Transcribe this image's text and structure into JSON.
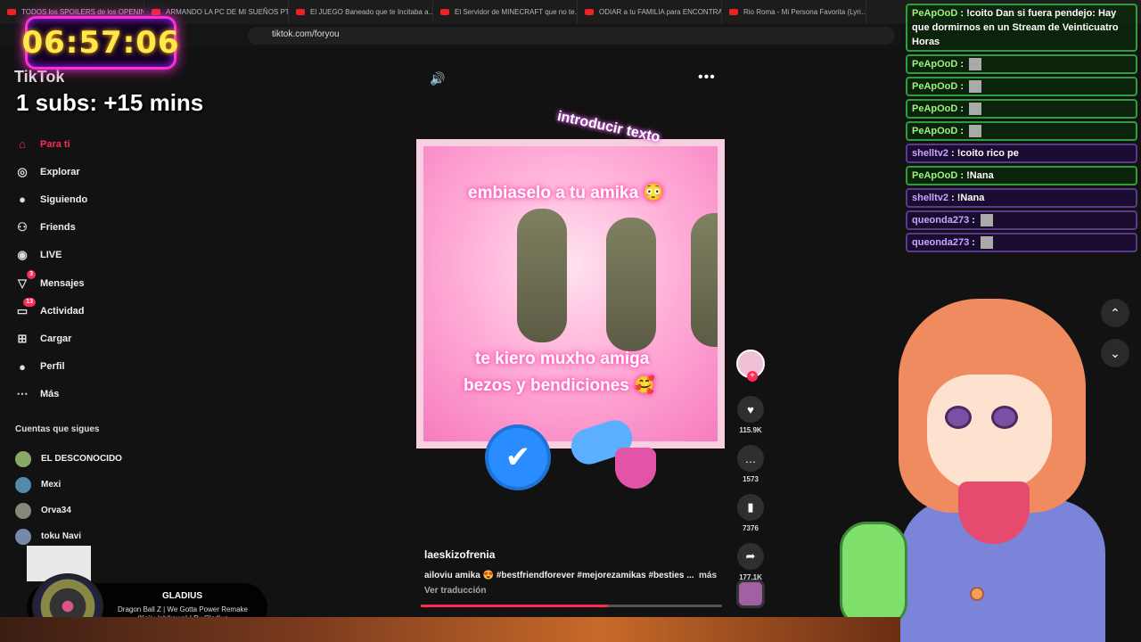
{
  "browser": {
    "tabs": [
      "TODOS los SPOILERS de los OPENIN…",
      "ARMANDO LA PC DE MI SUEÑOS PT…",
      "El JUEGO Baneado que te Incitaba a…",
      "El Servidor de MINECRAFT que no te…",
      "ODIAR a tu FAMILIA para ENCONTRA…",
      "Rio Roma - Mi Persona Favorita (Lyri…"
    ],
    "url": "tiktok.com/foryou"
  },
  "overlay": {
    "timer": "06:57:06",
    "subs_text": "1 subs: +15 mins"
  },
  "tiktok": {
    "logo": "TikTok",
    "nav": [
      {
        "label": "Para ti",
        "icon": "home-icon",
        "active": true
      },
      {
        "label": "Explorar",
        "icon": "compass-icon"
      },
      {
        "label": "Siguiendo",
        "icon": "following-icon"
      },
      {
        "label": "Friends",
        "icon": "friends-icon"
      },
      {
        "label": "LIVE",
        "icon": "live-icon"
      },
      {
        "label": "Mensajes",
        "icon": "messages-icon",
        "badge": "3"
      },
      {
        "label": "Actividad",
        "icon": "activity-icon",
        "badge": "13"
      },
      {
        "label": "Cargar",
        "icon": "upload-icon"
      },
      {
        "label": "Perfil",
        "icon": "profile-icon"
      },
      {
        "label": "Más",
        "icon": "more-icon"
      }
    ],
    "following_title": "Cuentas que sigues",
    "following": [
      "EL DESCONOCIDO",
      "Mexi",
      "Orva34",
      "toku Navi"
    ],
    "video": {
      "overlay_intro": "introducir texto",
      "line1": "embiaselo a tu amika 😳",
      "line2": "te kiero muxho amiga",
      "line3": "bezos y bendiciones 🥰"
    },
    "actions": {
      "likes": "115.9K",
      "comments": "1573",
      "saves": "7376",
      "shares": "177.1K"
    },
    "author": "laeskizofrenia",
    "caption": "ailoviu amika 😍 #bestfriendforever #mejorezamikas #besties ...",
    "more": "más",
    "translate": "Ver traducción",
    "progress": 0.62
  },
  "music": {
    "title": "GLADIUS",
    "subtitle": "Dragon Ball Z | We Gotta Power Remake (Keiju Ishikawa) | By Gladius"
  },
  "chat": [
    {
      "user": "PeApOoD",
      "text": "!coito Dan si fuera pendejo: Hay que dormirnos en un Stream de Veinticuatro Horas",
      "style": "green"
    },
    {
      "user": "PeApOoD",
      "text": "",
      "style": "green",
      "emote": true
    },
    {
      "user": "PeApOoD",
      "text": "",
      "style": "green",
      "emote": true
    },
    {
      "user": "PeApOoD",
      "text": "",
      "style": "green",
      "emote": true
    },
    {
      "user": "PeApOoD",
      "text": "",
      "style": "green",
      "emote": true
    },
    {
      "user": "shelltv2",
      "text": "!coito rico pe",
      "style": "purple"
    },
    {
      "user": "PeApOoD",
      "text": "!Nana",
      "style": "green"
    },
    {
      "user": "shelltv2",
      "text": "!Nana",
      "style": "purple"
    },
    {
      "user": "queonda273",
      "text": "",
      "style": "purple",
      "emote": true
    },
    {
      "user": "queonda273",
      "text": "",
      "style": "purple",
      "emote": true
    }
  ]
}
